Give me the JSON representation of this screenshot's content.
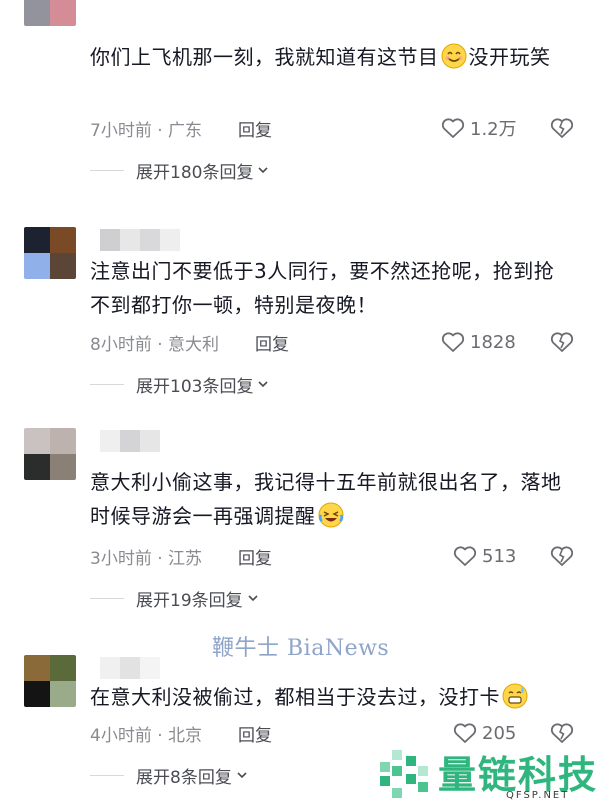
{
  "comments": [
    {
      "text_before": "你们上飞机那一刻，我就知道有这节目",
      "emoji": "smiling-face-emoji",
      "text_after": "没开玩笑",
      "time": "7小时前",
      "location": "广东",
      "reply_label": "回复",
      "likes": "1.2万",
      "expand_label": "展开180条回复"
    },
    {
      "text_before": "注意出门不要低于3人同行，要不然还抢呢，抢到抢不到都打你一顿，特别是夜晚！",
      "emoji": "",
      "text_after": "",
      "time": "8小时前",
      "location": "意大利",
      "reply_label": "回复",
      "likes": "1828",
      "expand_label": "展开103条回复"
    },
    {
      "text_before": "意大利小偷这事，我记得十五年前就很出名了，落地时候导游会一再强调提醒",
      "emoji": "laughing-crying-emoji",
      "text_after": "",
      "time": "3小时前",
      "location": "江苏",
      "reply_label": "回复",
      "likes": "513",
      "expand_label": "展开19条回复"
    },
    {
      "text_before": "在意大利没被偷过，都相当于没去过，没打卡",
      "emoji": "grinning-sweat-emoji",
      "text_after": "",
      "time": "4小时前",
      "location": "北京",
      "reply_label": "回复",
      "likes": "205",
      "expand_label": "展开8条回复"
    }
  ],
  "meta_separator": " · ",
  "watermark": "鞭牛士 BiaNews",
  "brand": {
    "name": "量链科技",
    "url": "QFSP.NET",
    "color": "#2fb57e"
  },
  "colors": {
    "text": "#161823",
    "meta": "#8a8b91",
    "reply": "#4b4c53"
  }
}
